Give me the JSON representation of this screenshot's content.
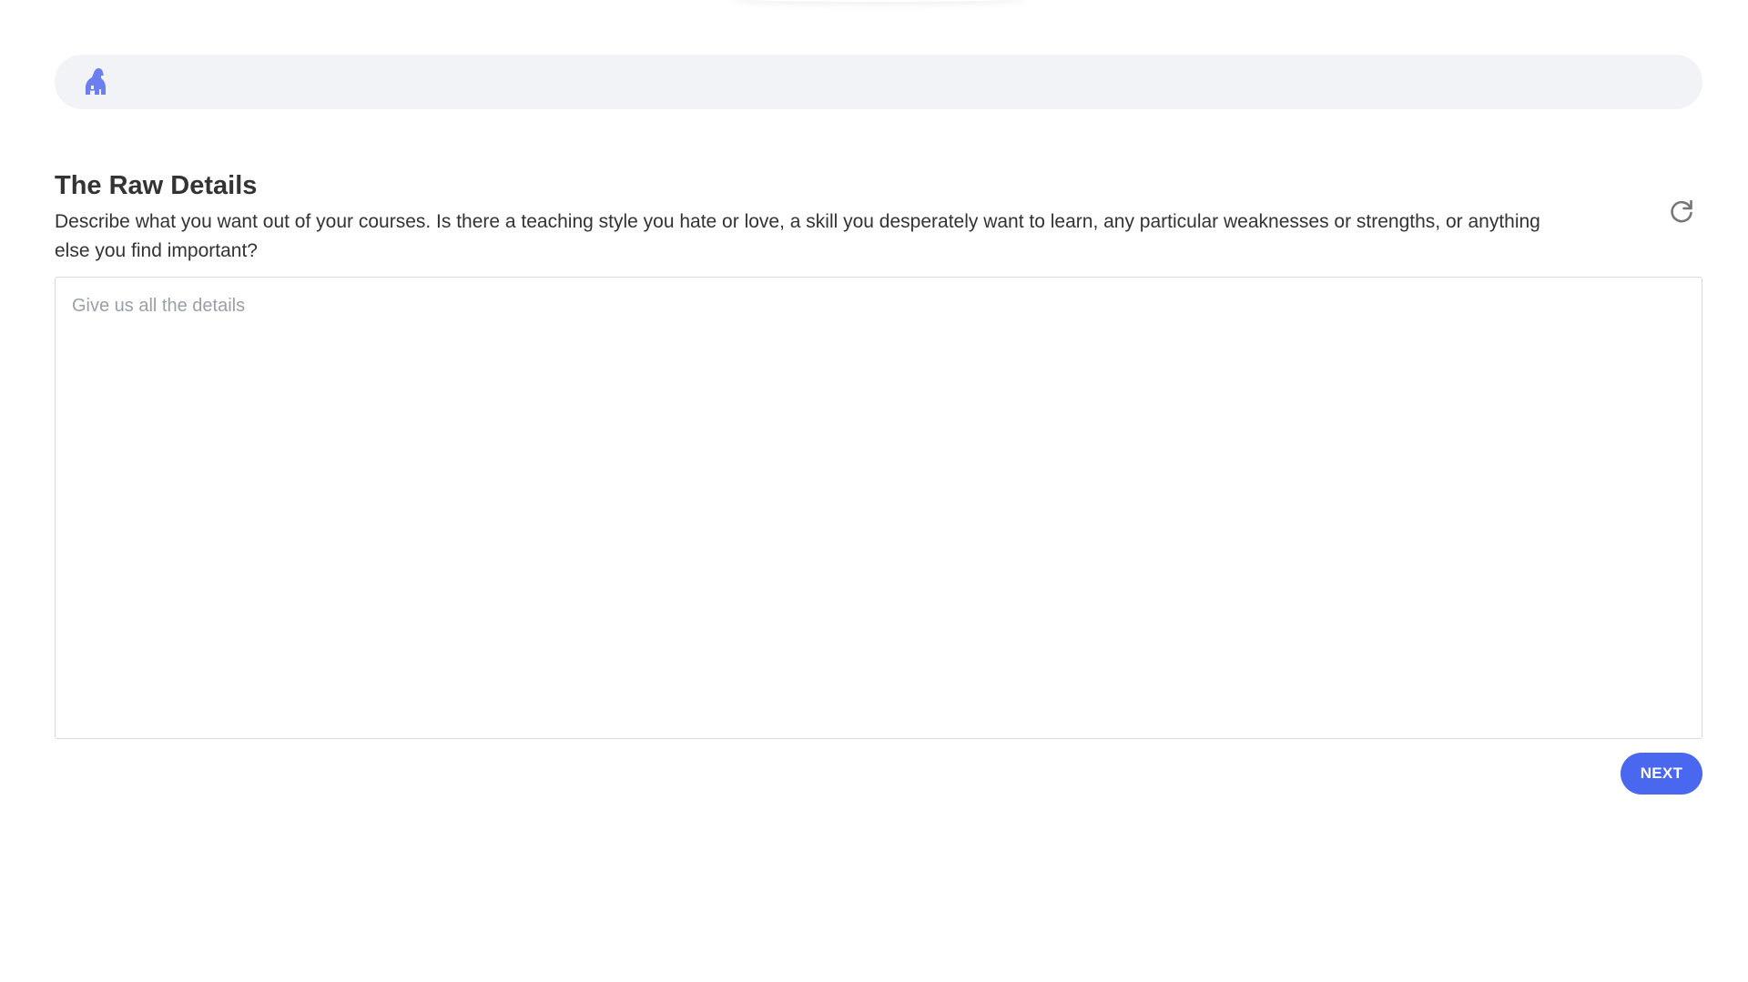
{
  "header": {
    "logo_icon": "gorilla-icon",
    "logo_color": "#6b7ff0",
    "background": "#f2f3f7"
  },
  "section": {
    "title": "The Raw Details",
    "description": "Describe what you want out of your courses. Is there a teaching style you hate or love, a skill you desperately want to learn, any particular weaknesses or strengths, or anything else you find important?",
    "refresh_icon": "refresh-icon"
  },
  "details_input": {
    "value": "",
    "placeholder": "Give us all the details"
  },
  "actions": {
    "next_label": "NEXT",
    "next_color": "#4a67f0"
  }
}
